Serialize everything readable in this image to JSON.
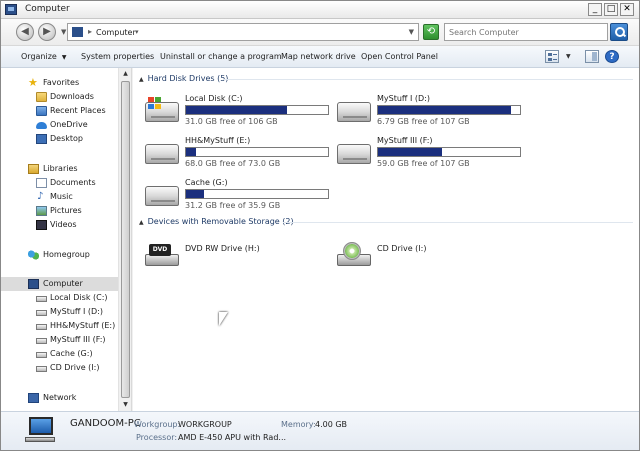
{
  "window": {
    "title": "Computer",
    "minimize": "_",
    "maximize": "□",
    "close": "✕"
  },
  "address": {
    "path": "Computer",
    "search_placeholder": "Search Computer"
  },
  "toolbar": {
    "organize": "Organize",
    "system_properties": "System properties",
    "uninstall": "Uninstall or change a program",
    "map_drive": "Map network drive",
    "control_panel": "Open Control Panel",
    "help": "?"
  },
  "nav": {
    "favorites": {
      "label": "Favorites",
      "items": [
        "Downloads",
        "Recent Places",
        "OneDrive",
        "Desktop"
      ]
    },
    "libraries": {
      "label": "Libraries",
      "items": [
        "Documents",
        "Music",
        "Pictures",
        "Videos"
      ]
    },
    "homegroup": "Homegroup",
    "computer": {
      "label": "Computer",
      "items": [
        "Local Disk (C:)",
        "MyStuff I (D:)",
        "HH&MyStuff (E:)",
        "MyStuff III (F:)",
        "Cache (G:)",
        "CD Drive (I:)"
      ]
    },
    "network": "Network"
  },
  "groups": {
    "hdd_header": "Hard Disk Drives (5)",
    "removable_header": "Devices with Removable Storage (2)"
  },
  "drives": [
    {
      "name": "Local Disk (C:)",
      "free": "31.0 GB free of 106 GB",
      "used_fraction": 0.71
    },
    {
      "name": "MyStuff I (D:)",
      "free": "6.79 GB free of 107 GB",
      "used_fraction": 0.94
    },
    {
      "name": "HH&MyStuff (E:)",
      "free": "68.0 GB free of 73.0 GB",
      "used_fraction": 0.07
    },
    {
      "name": "MyStuff III (F:)",
      "free": "59.0 GB free of 107 GB",
      "used_fraction": 0.45
    },
    {
      "name": "Cache (G:)",
      "free": "31.2 GB free of 35.9 GB",
      "used_fraction": 0.13
    }
  ],
  "removable": [
    {
      "name": "DVD RW Drive (H:)",
      "badge": "DVD"
    },
    {
      "name": "CD Drive (I:)"
    }
  ],
  "details": {
    "pc_name": "GANDOOM-PC",
    "workgroup_label": "Workgroup:",
    "workgroup_value": "WORKGROUP",
    "memory_label": "Memory:",
    "memory_value": "4.00 GB",
    "processor_label": "Processor:",
    "processor_value": "AMD E-450 APU with Rad..."
  },
  "colors": {
    "usage_bar": "#1b2f7e",
    "group_header": "#1e3a66",
    "selection": "#dcdcdc"
  }
}
